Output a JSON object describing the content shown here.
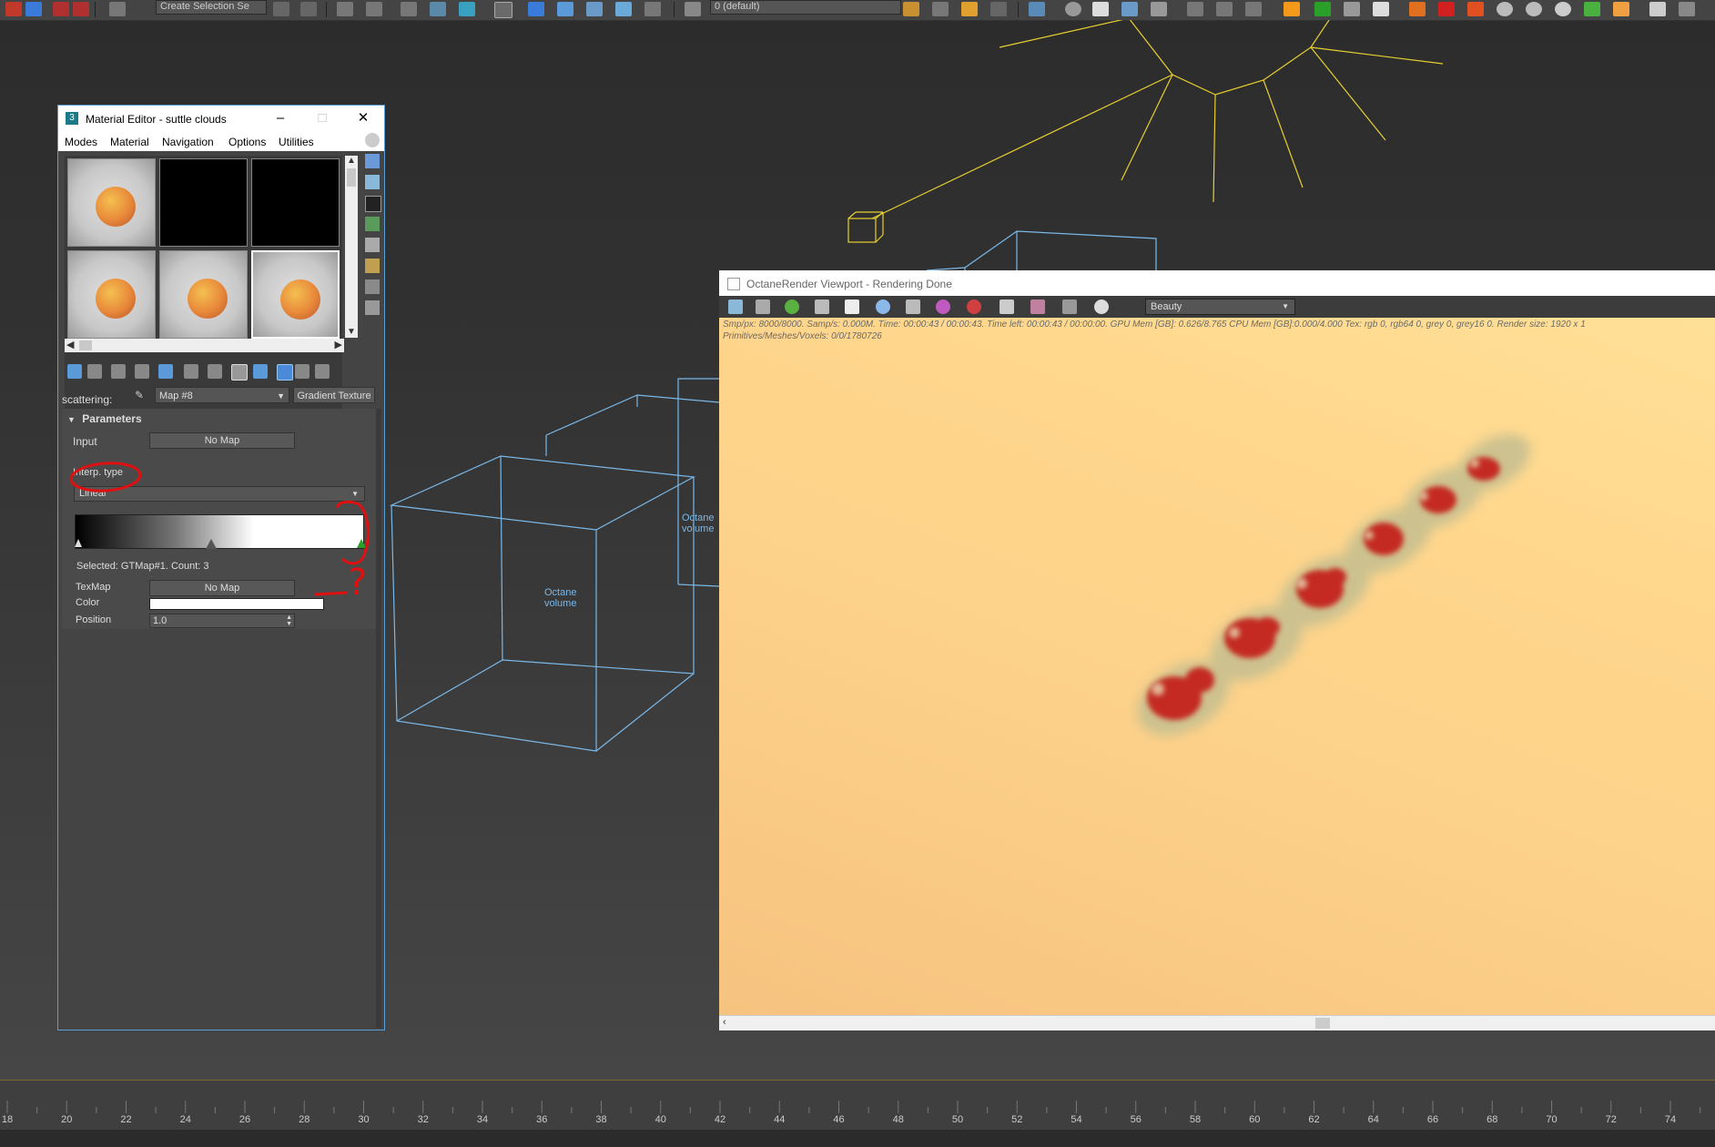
{
  "toolbar": {
    "selection_set": "Create Selection Se",
    "layer": "0 (default)",
    "accent_colors": {
      "orange": "#f39a1a",
      "red": "#d02020",
      "green": "#2aa02a",
      "blue": "#3a7ad8"
    }
  },
  "viewport": {
    "labels": [
      "Octane",
      "volume",
      "Octane",
      "volume"
    ],
    "wire_colors": {
      "light": "#e8d030",
      "volume": "#7ab8e8"
    }
  },
  "material_editor": {
    "title": "Material Editor - suttle clouds",
    "menu": [
      "Modes",
      "Material",
      "Navigation",
      "Options",
      "Utilities"
    ],
    "slots": [
      "sphere",
      "black",
      "black",
      "sphere",
      "sphere",
      "sphere"
    ],
    "map_label": "scattering:",
    "map_name": "Map #8",
    "map_type": "Gradient Texture",
    "params": {
      "header": "Parameters",
      "input_label": "Input",
      "input_value": "No Map",
      "interp_label": "Interp. type",
      "interp_value": "Linear",
      "selected_info": "Selected: GTMap#1. Count: 3",
      "texmap_label": "TexMap",
      "texmap_value": "No Map",
      "color_label": "Color",
      "color_value": "#ffffff",
      "position_label": "Position",
      "position_value": "1.0"
    },
    "annotation_mark": "?",
    "annotation_color": "#e01010"
  },
  "octane": {
    "title": "OctaneRender Viewport - Rendering Done",
    "render_pass": "Beauty",
    "stats_line1": "Smp/px: 8000/8000.   Samp/s: 0.000M.   Time: 00:00:43 / 00:00:43.   Time left: 00:00:43 / 00:00:00.   GPU Mem [GB]: 0.626/8.765   CPU Mem [GB]:0.000/4.000   Tex: rgb 0, rgb64 0, grey 0, grey16 0.   Render size: 1920 x 1",
    "stats_line2": "Primitives/Meshes/Voxels: 0/0/1780726"
  },
  "timeline": {
    "ticks": [
      "18",
      "20",
      "22",
      "24",
      "26",
      "28",
      "30",
      "32",
      "34",
      "36",
      "38",
      "40",
      "42",
      "44",
      "46",
      "48",
      "50",
      "52",
      "54",
      "56",
      "58",
      "60",
      "62",
      "64",
      "66",
      "68",
      "70",
      "72",
      "74"
    ]
  }
}
